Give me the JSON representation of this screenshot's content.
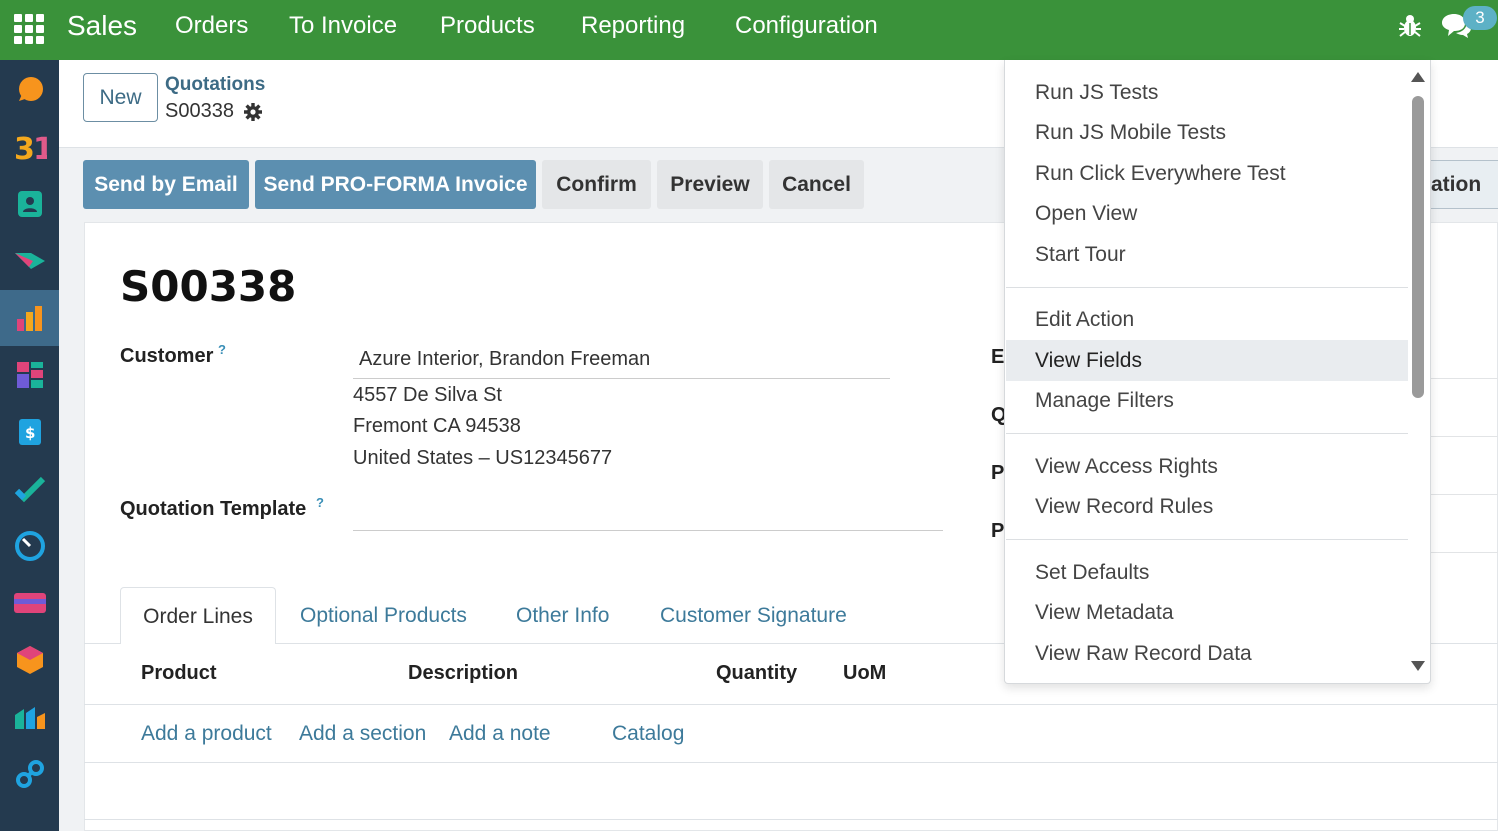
{
  "navbar": {
    "app_name": "Sales",
    "menu": [
      "Orders",
      "To Invoice",
      "Products",
      "Reporting",
      "Configuration"
    ],
    "chat_count": "3",
    "icons": [
      "apps-grid-icon",
      "bug-icon",
      "chat-icon"
    ],
    "bg_color": "#3a923a"
  },
  "sidebar": {
    "apps": [
      "discuss-icon",
      "calendar-icon",
      "contacts-icon",
      "crm-icon",
      "sales-icon",
      "dashboards-icon",
      "invoicing-icon",
      "project-icon",
      "timesheets-icon",
      "subscriptions-icon",
      "inventory-icon",
      "manufacturing-icon",
      "website-icon"
    ],
    "active_index": 4
  },
  "control_panel": {
    "new_label": "New",
    "breadcrumb_parent": "Quotations",
    "breadcrumb_current": "S00338"
  },
  "status_bar": {
    "buttons": [
      "Send by Email",
      "Send PRO-FORMA Invoice",
      "Confirm",
      "Preview",
      "Cancel"
    ],
    "stage_visible": "ation"
  },
  "form": {
    "title": "S00338",
    "customer_label": "Customer",
    "help_mark": "?",
    "customer_name": "Azure Interior, Brandon Freeman",
    "address": [
      "4557 De Silva St",
      "Fremont CA 94538",
      "United States – US12345677"
    ],
    "template_label": "Quotation Template",
    "right_labels": [
      "Ex",
      "Q",
      "P",
      "P"
    ]
  },
  "notebook": {
    "tabs": [
      "Order Lines",
      "Optional Products",
      "Other Info",
      "Customer Signature"
    ],
    "active_tab": "Order Lines",
    "columns": [
      "Product",
      "Description",
      "Quantity",
      "UoM"
    ],
    "add_links": [
      "Add a product",
      "Add a section",
      "Add a note",
      "Catalog"
    ]
  },
  "debug_menu": {
    "groups": [
      [
        "Run JS Tests",
        "Run JS Mobile Tests",
        "Run Click Everywhere Test",
        "Open View",
        "Start Tour"
      ],
      [
        "Edit Action",
        "View Fields",
        "Manage Filters"
      ],
      [
        "View Access Rights",
        "View Record Rules"
      ],
      [
        "Set Defaults",
        "View Metadata",
        "View Raw Record Data"
      ]
    ],
    "hovered": "View Fields"
  }
}
